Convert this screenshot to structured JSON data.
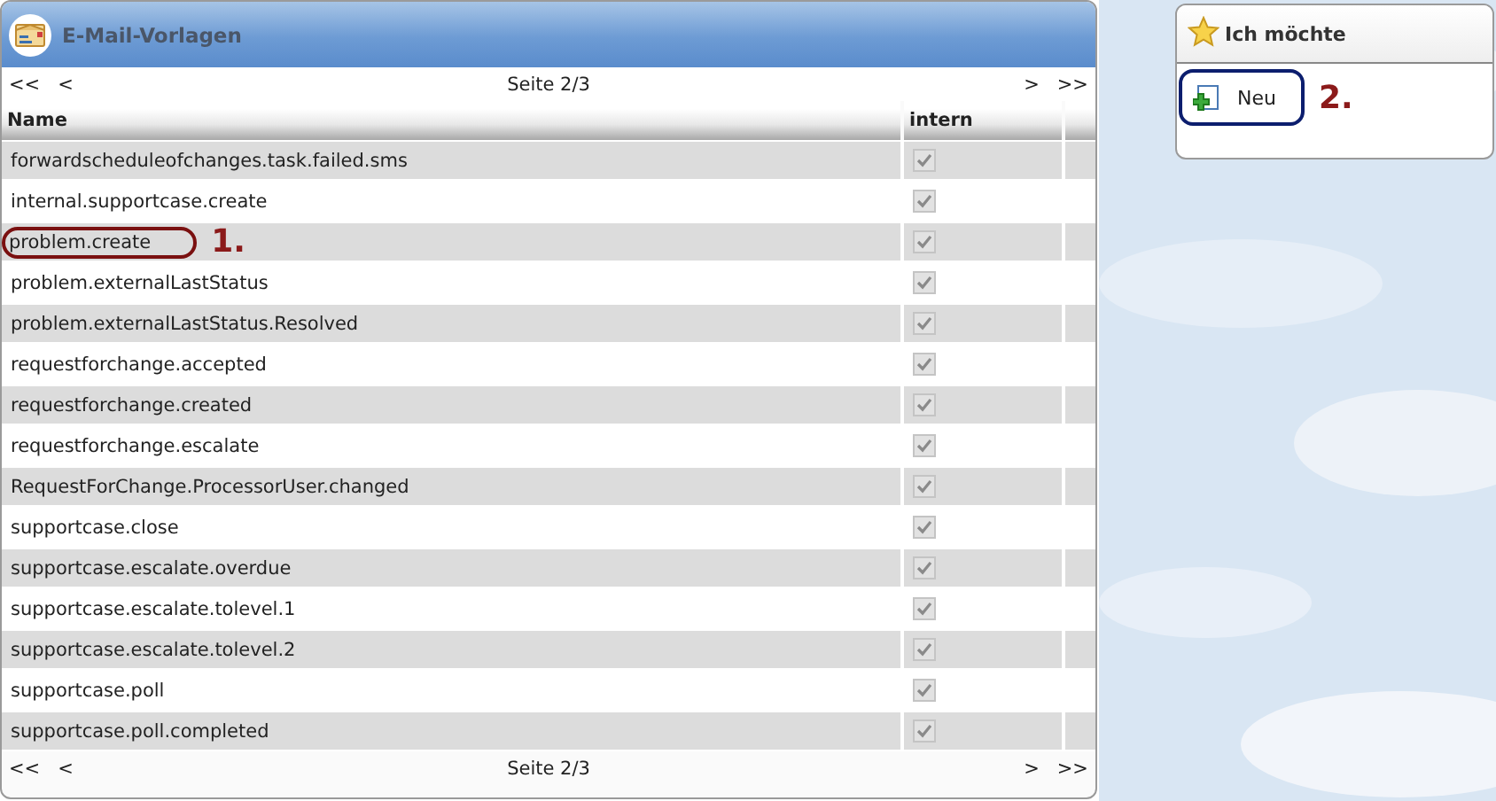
{
  "panel": {
    "title": "E-Mail-Vorlagen"
  },
  "pager_top": {
    "first": "<<",
    "prev": "<",
    "page": "Seite 2/3",
    "next": ">",
    "last": ">>"
  },
  "table": {
    "columns": [
      "Name",
      "intern"
    ],
    "rows": [
      {
        "name": "forwardscheduleofchanges.task.failed.sms",
        "intern": true
      },
      {
        "name": "internal.supportcase.create",
        "intern": true
      },
      {
        "name": "problem.create",
        "intern": true,
        "marker": "1."
      },
      {
        "name": "problem.externalLastStatus",
        "intern": true
      },
      {
        "name": "problem.externalLastStatus.Resolved",
        "intern": true
      },
      {
        "name": "requestforchange.accepted",
        "intern": true
      },
      {
        "name": "requestforchange.created",
        "intern": true
      },
      {
        "name": "requestforchange.escalate",
        "intern": true
      },
      {
        "name": "RequestForChange.ProcessorUser.changed",
        "intern": true
      },
      {
        "name": "supportcase.close",
        "intern": true
      },
      {
        "name": "supportcase.escalate.overdue",
        "intern": true
      },
      {
        "name": "supportcase.escalate.tolevel.1",
        "intern": true
      },
      {
        "name": "supportcase.escalate.tolevel.2",
        "intern": true
      },
      {
        "name": "supportcase.poll",
        "intern": true
      },
      {
        "name": "supportcase.poll.completed",
        "intern": true
      }
    ]
  },
  "pager_bottom": {
    "first": "<<",
    "prev": "<",
    "page": "Seite 2/3",
    "next": ">",
    "last": ">>"
  },
  "actions": {
    "title": "Ich möchte",
    "items": [
      {
        "label": "Neu",
        "marker": "2."
      }
    ]
  }
}
